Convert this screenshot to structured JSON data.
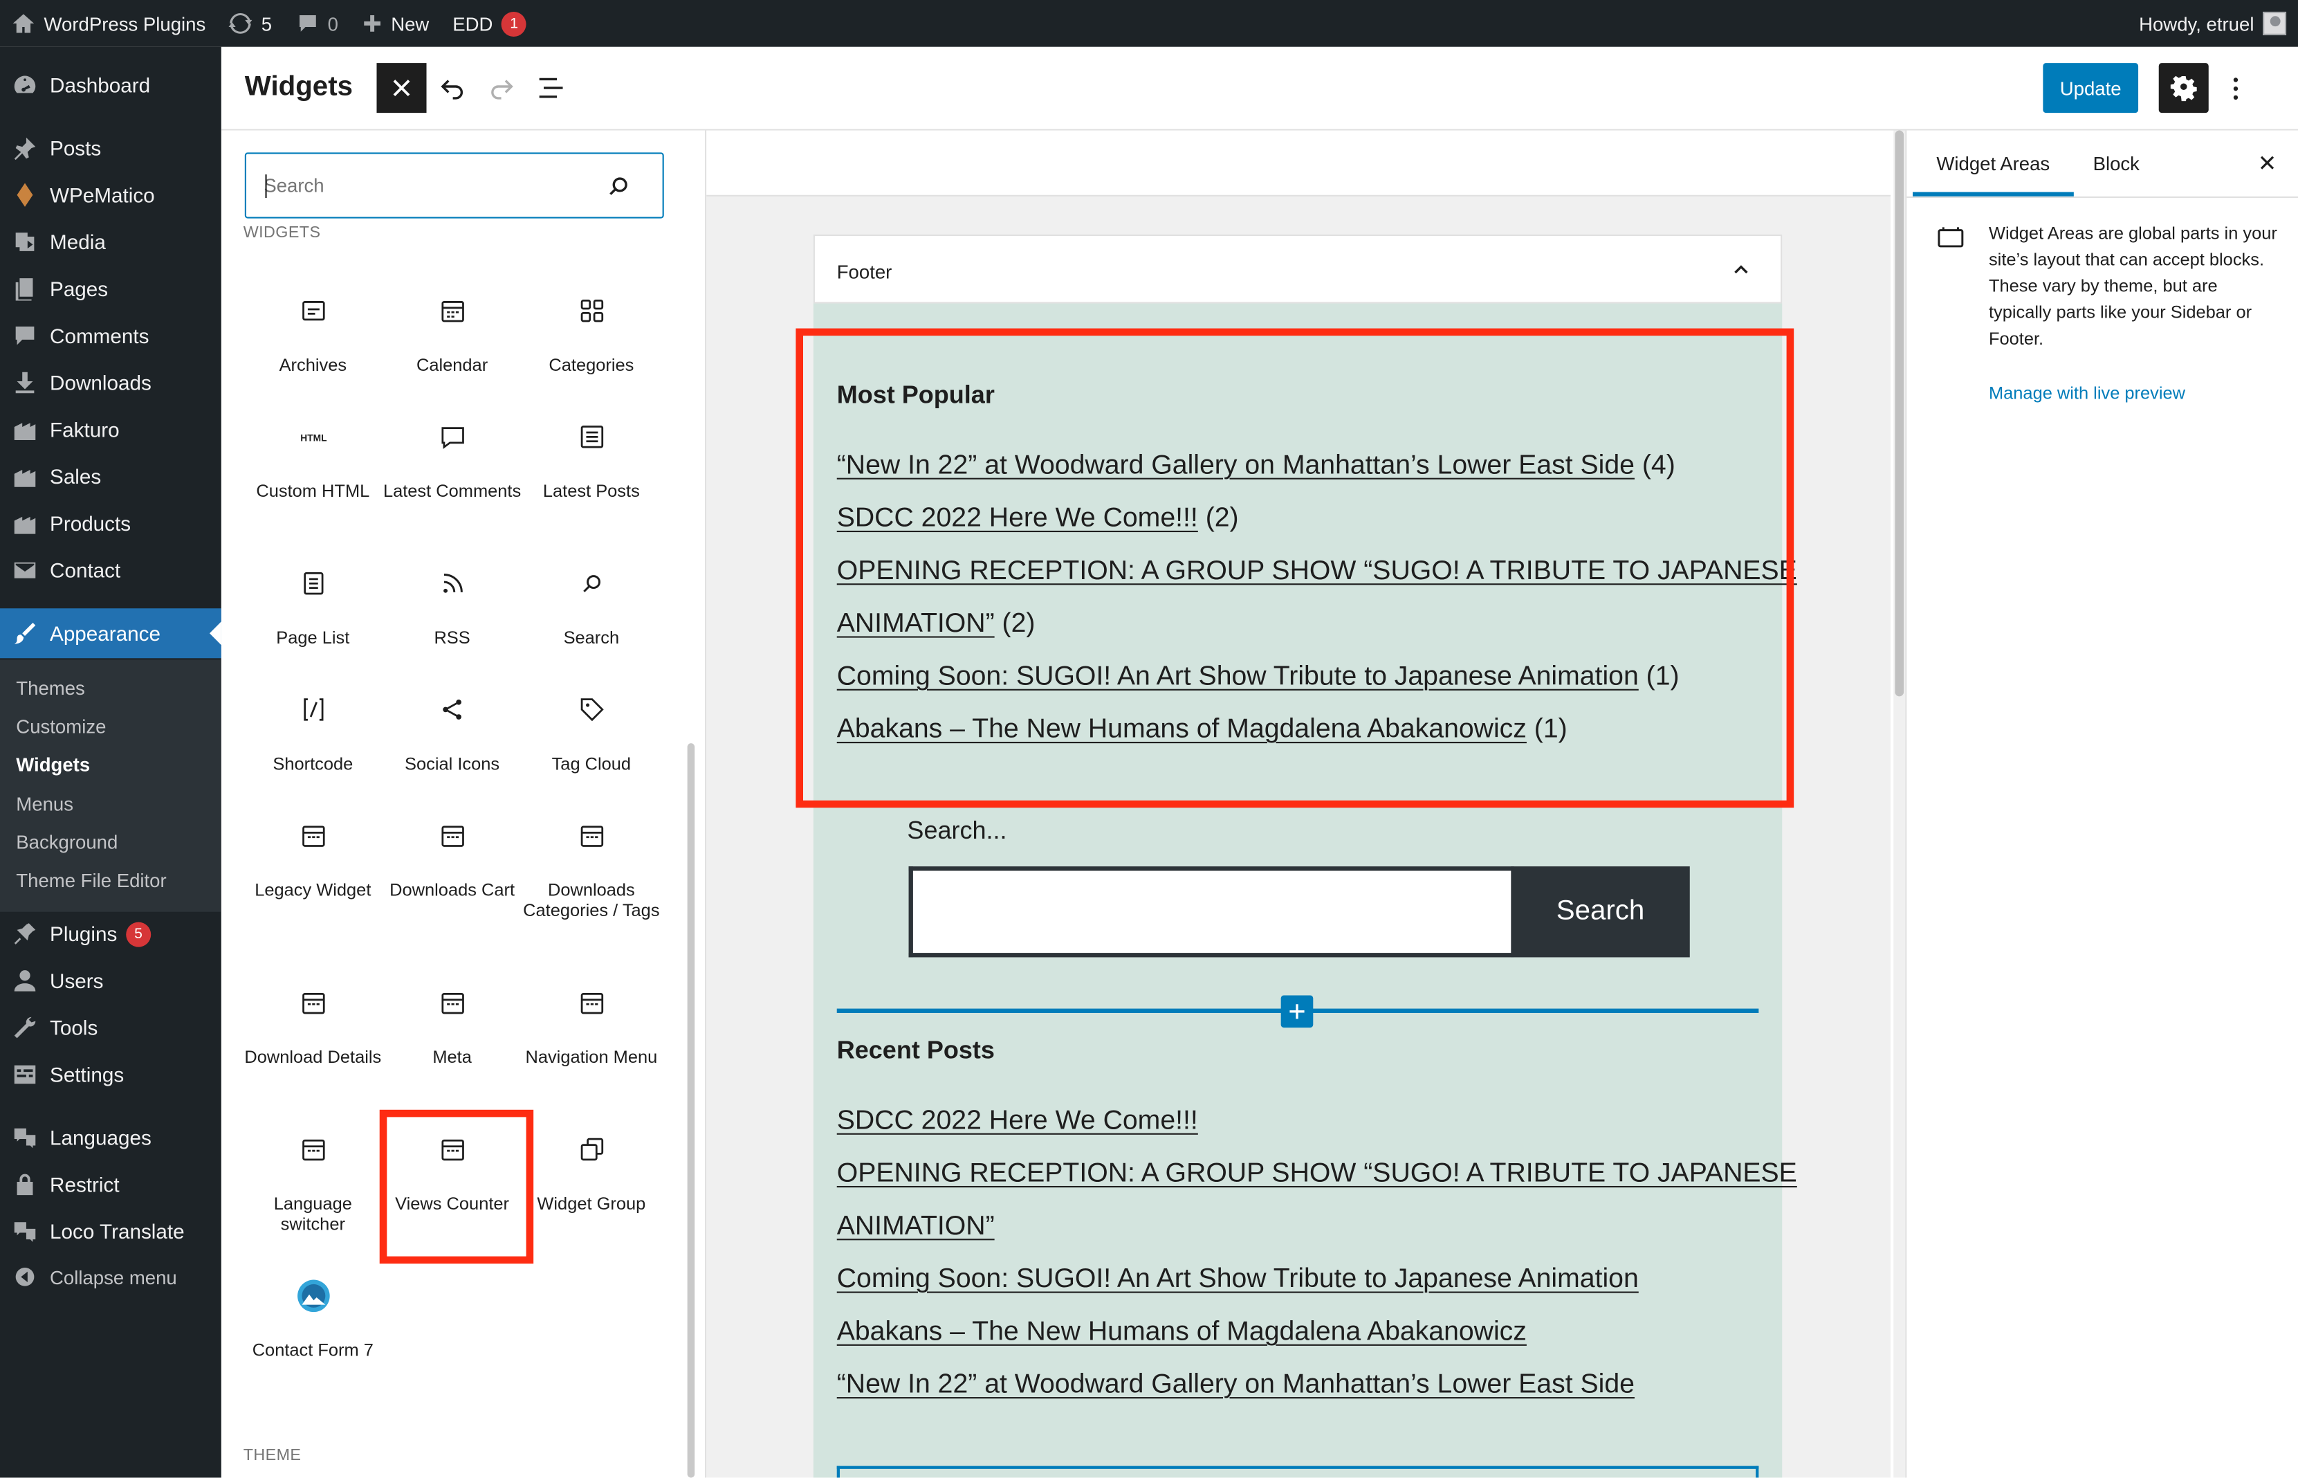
{
  "admin_bar": {
    "site_name": "WordPress Plugins",
    "updates_count": "5",
    "comments_count": "0",
    "new_label": "New",
    "edd_label": "EDD",
    "edd_badge": "1",
    "howdy": "Howdy, etruel"
  },
  "admin_menu": {
    "items": [
      {
        "label": "Dashboard",
        "icon": "dashboard-icon"
      },
      {
        "label": "Posts",
        "icon": "pin-icon"
      },
      {
        "label": "WPeMatico",
        "icon": "diamond-icon"
      },
      {
        "label": "Media",
        "icon": "media-icon"
      },
      {
        "label": "Pages",
        "icon": "pages-icon"
      },
      {
        "label": "Comments",
        "icon": "comment-icon"
      },
      {
        "label": "Downloads",
        "icon": "download-icon"
      },
      {
        "label": "Fakturo",
        "icon": "building-icon"
      },
      {
        "label": "Sales",
        "icon": "building-icon"
      },
      {
        "label": "Products",
        "icon": "building-icon"
      },
      {
        "label": "Contact",
        "icon": "mail-icon"
      },
      {
        "label": "Appearance",
        "icon": "brush-icon"
      },
      {
        "label": "Plugins",
        "icon": "plug-icon",
        "badge": "5"
      },
      {
        "label": "Users",
        "icon": "user-icon"
      },
      {
        "label": "Tools",
        "icon": "wrench-icon"
      },
      {
        "label": "Settings",
        "icon": "settings-icon"
      },
      {
        "label": "Languages",
        "icon": "translate-icon"
      },
      {
        "label": "Restrict",
        "icon": "lock-icon"
      },
      {
        "label": "Loco Translate",
        "icon": "translate-icon"
      },
      {
        "label": "Collapse menu",
        "icon": "collapse-icon"
      }
    ],
    "appearance_submenu": [
      "Themes",
      "Customize",
      "Widgets",
      "Menus",
      "Background",
      "Theme File Editor"
    ]
  },
  "editor_header": {
    "title": "Widgets",
    "update_label": "Update"
  },
  "inserter": {
    "search_placeholder": "Search",
    "section_widgets": "WIDGETS",
    "section_theme": "THEME",
    "blocks": [
      {
        "label": "Archives",
        "icon": "archive-icon"
      },
      {
        "label": "Calendar",
        "icon": "calendar-icon"
      },
      {
        "label": "Categories",
        "icon": "grid-icon"
      },
      {
        "label": "Custom HTML",
        "icon": "html-icon"
      },
      {
        "label": "Latest Comments",
        "icon": "comment-icon"
      },
      {
        "label": "Latest Posts",
        "icon": "list-icon"
      },
      {
        "label": "Page List",
        "icon": "page-list-icon"
      },
      {
        "label": "RSS",
        "icon": "rss-icon"
      },
      {
        "label": "Search",
        "icon": "search-icon"
      },
      {
        "label": "Shortcode",
        "icon": "shortcode-icon"
      },
      {
        "label": "Social Icons",
        "icon": "share-icon"
      },
      {
        "label": "Tag Cloud",
        "icon": "tag-icon"
      },
      {
        "label": "Legacy Widget",
        "icon": "widget-icon"
      },
      {
        "label": "Downloads Cart",
        "icon": "widget-icon"
      },
      {
        "label": "Downloads Categories / Tags",
        "icon": "widget-icon"
      },
      {
        "label": "Download Details",
        "icon": "widget-icon"
      },
      {
        "label": "Meta",
        "icon": "widget-icon"
      },
      {
        "label": "Navigation Menu",
        "icon": "widget-icon"
      },
      {
        "label": "Language switcher",
        "icon": "widget-icon"
      },
      {
        "label": "Views Counter",
        "icon": "widget-icon"
      },
      {
        "label": "Widget Group",
        "icon": "group-icon"
      },
      {
        "label": "Contact Form 7",
        "icon": "contact-form-icon"
      }
    ]
  },
  "canvas": {
    "area_title": "Footer",
    "most_popular": {
      "title": "Most Popular",
      "lines": [
        {
          "link": "“New In 22” at Woodward Gallery on Manhattan’s Lower East Side",
          "suffix": " (4)"
        },
        {
          "link": "SDCC 2022 Here We Come!!!",
          "suffix": " (2)"
        },
        {
          "link": "OPENING RECEPTION: A GROUP SHOW “SUGO! A TRIBUTE TO JAPANESE",
          "suffix": ""
        },
        {
          "link": "ANIMATION”",
          "suffix": " (2)"
        },
        {
          "link": "Coming Soon: SUGOI! An Art Show Tribute to Japanese Animation",
          "suffix": " (1)"
        },
        {
          "link": "Abakans – The New Humans of Magdalena Abakanowicz",
          "suffix": " (1)"
        }
      ]
    },
    "search_widget": {
      "label": "Search...",
      "button": "Search"
    },
    "recent_posts": {
      "title": "Recent Posts",
      "lines": [
        "SDCC 2022 Here We Come!!!",
        "OPENING RECEPTION: A GROUP SHOW “SUGO! A TRIBUTE TO JAPANESE",
        "ANIMATION”",
        "Coming Soon: SUGOI! An Art Show Tribute to Japanese Animation",
        "Abakans – The New Humans of Magdalena Abakanowicz",
        "“New In 22” at Woodward Gallery on Manhattan’s Lower East Side"
      ]
    }
  },
  "sidebar": {
    "tab_widget_areas": "Widget Areas",
    "tab_block": "Block",
    "description": "Widget Areas are global parts in your site’s layout that can accept blocks. These vary by theme, but are typically parts like your Sidebar or Footer.",
    "manage_link": "Manage with live preview"
  },
  "colors": {
    "admin_dark": "#1d2327",
    "accent_blue": "#007cba",
    "menu_active": "#2271b1",
    "widget_area_bg": "#d3e4de",
    "highlight_red": "#fe2c12"
  }
}
